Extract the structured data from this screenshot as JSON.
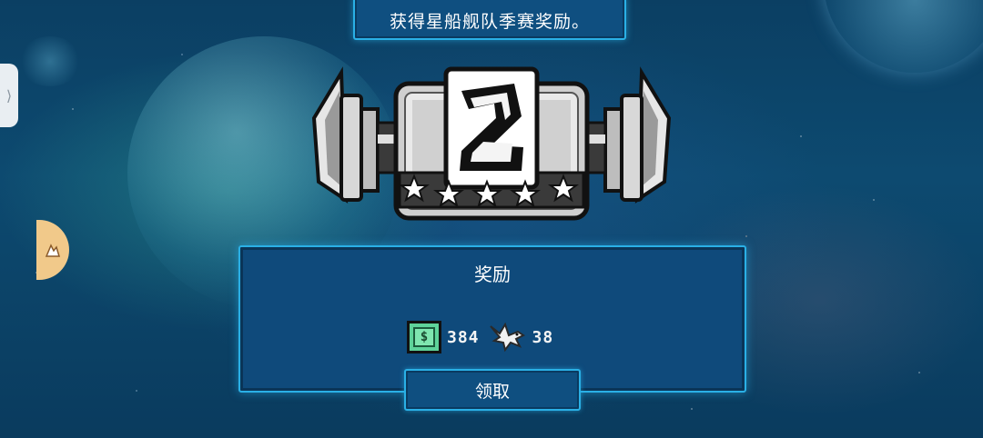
{
  "banner": {
    "text": "获得星船舰队季赛奖励。"
  },
  "trophy": {
    "rank_digit": "2",
    "stars": 5
  },
  "rewards": {
    "title": "奖励",
    "items": [
      {
        "icon": "cash-icon",
        "symbol": "$",
        "value": "384"
      },
      {
        "icon": "bird-icon",
        "value": "38"
      }
    ]
  },
  "claim_button": {
    "label": "领取"
  },
  "side": {
    "handle_glyph": "⟩"
  },
  "colors": {
    "panel_bg": "#0f4a7b",
    "panel_border": "#2ab0e6",
    "cash_green": "#5ed39a",
    "bubble": "#f1c98a"
  }
}
